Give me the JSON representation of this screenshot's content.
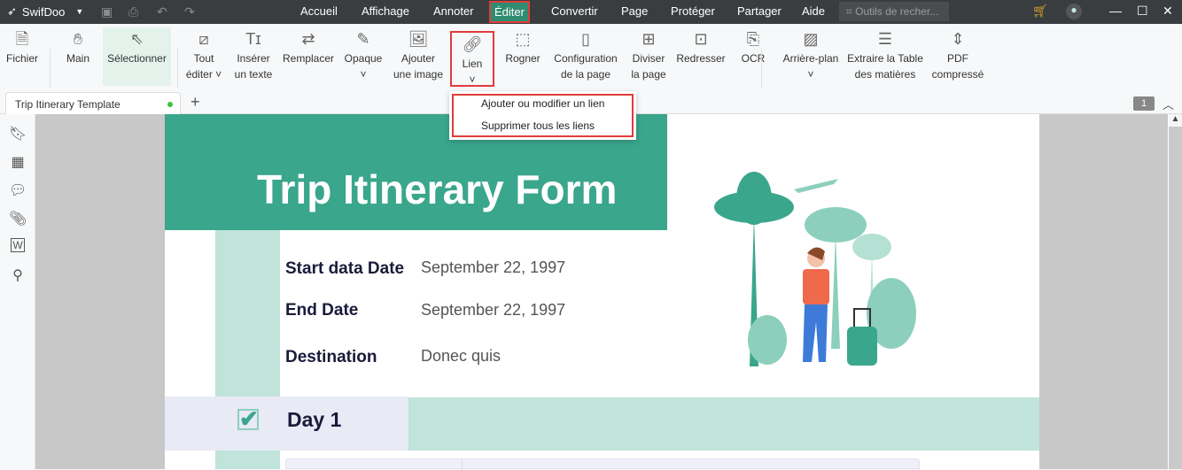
{
  "app": {
    "name": "SwifDoo"
  },
  "menus": [
    "Accueil",
    "Affichage",
    "Annoter",
    "Éditer",
    "Convertir",
    "Page",
    "Protéger",
    "Partager",
    "Aide"
  ],
  "active_menu": "Éditer",
  "search": {
    "placeholder": "Outils de recher..."
  },
  "ribbon": [
    {
      "id": "fichier",
      "label": "Fichier",
      "icon": "file-icon"
    },
    {
      "id": "main",
      "label": "Main",
      "icon": "hand-icon"
    },
    {
      "id": "selectionner",
      "label": "Sélectionner",
      "icon": "cursor-icon"
    },
    {
      "id": "tout-editer",
      "label": "Tout éditer",
      "icon": "edit-all-icon"
    },
    {
      "id": "inserer-texte",
      "label": "Insérer un texte",
      "icon": "insert-text-icon"
    },
    {
      "id": "remplacer",
      "label": "Remplacer",
      "icon": "replace-icon"
    },
    {
      "id": "opaque",
      "label": "Opaque",
      "icon": "eraser-icon"
    },
    {
      "id": "ajouter-image",
      "label": "Ajouter une image",
      "icon": "image-icon"
    },
    {
      "id": "lien",
      "label": "Lien",
      "icon": "link-icon"
    },
    {
      "id": "rogner",
      "label": "Rogner",
      "icon": "crop-icon"
    },
    {
      "id": "config-page",
      "label": "Configuration de la page",
      "icon": "page-setup-icon"
    },
    {
      "id": "diviser",
      "label": "Diviser la page",
      "icon": "split-icon"
    },
    {
      "id": "redresser",
      "label": "Redresser",
      "icon": "deskew-icon"
    },
    {
      "id": "ocr",
      "label": "OCR",
      "icon": "ocr-icon"
    },
    {
      "id": "arriere-plan",
      "label": "Arrière-plan",
      "icon": "background-icon"
    },
    {
      "id": "extraire-toc",
      "label": "Extraire la Table des matières",
      "icon": "toc-icon"
    },
    {
      "id": "pdf-compresse",
      "label": "PDF compressé",
      "icon": "compress-icon"
    }
  ],
  "ribbon_lines": {
    "fichier": [
      "Fichier"
    ],
    "main": [
      "Main"
    ],
    "selectionner": [
      "Sélectionner"
    ],
    "tout-editer": [
      "Tout",
      "éditer ˅"
    ],
    "inserer-texte": [
      "Insérer",
      "un texte"
    ],
    "remplacer": [
      "Remplacer"
    ],
    "opaque": [
      "Opaque",
      "˅"
    ],
    "ajouter-image": [
      "Ajouter",
      "une image"
    ],
    "lien": [
      "Lien",
      "˅"
    ],
    "rogner": [
      "Rogner"
    ],
    "config-page": [
      "Configuration",
      "de la page"
    ],
    "diviser": [
      "Diviser",
      "la page"
    ],
    "redresser": [
      "Redresser"
    ],
    "ocr": [
      "OCR"
    ],
    "arriere-plan": [
      "Arrière-plan",
      "˅"
    ],
    "extraire-toc": [
      "Extraire la Table",
      "des matières"
    ],
    "pdf-compresse": [
      "PDF",
      "compressé"
    ]
  },
  "dropdown": {
    "items": [
      "Ajouter ou modifier un lien",
      "Supprimer tous les liens"
    ]
  },
  "tab": {
    "title": "Trip Itinerary Template",
    "add": "+"
  },
  "page_number": "1",
  "document": {
    "title": "Trip Itinerary Form",
    "fields": [
      {
        "label": "Start data Date",
        "value": "September 22, 1997"
      },
      {
        "label": "End Date",
        "value": "September 22, 1997"
      },
      {
        "label": "Destination",
        "value": "Donec quis"
      }
    ],
    "day": "Day 1"
  },
  "colors": {
    "accent": "#3aa68c",
    "light_accent": "#c0e3da",
    "highlight": "#e03c3c",
    "day_bg": "#e8eaf6"
  }
}
